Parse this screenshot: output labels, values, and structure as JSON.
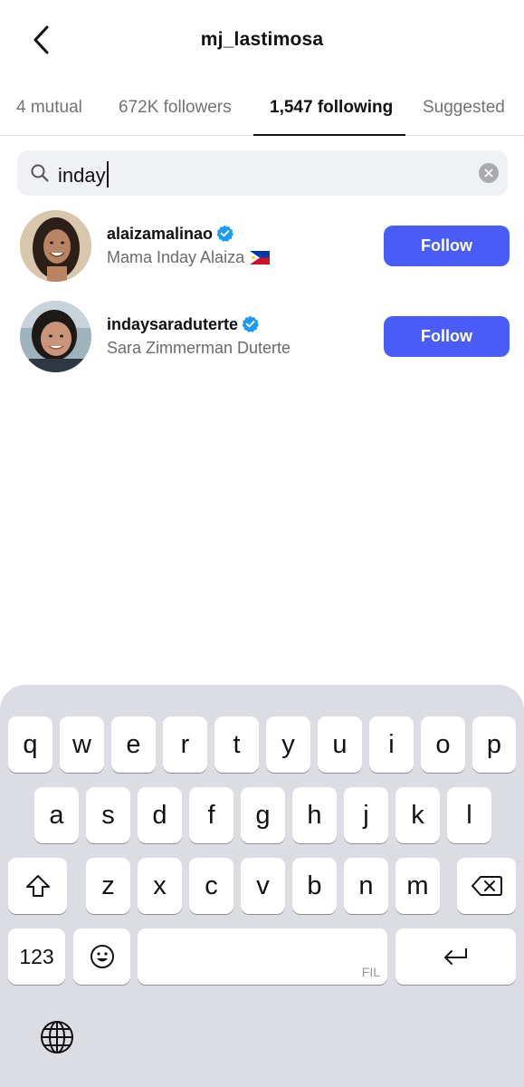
{
  "header": {
    "title": "mj_lastimosa"
  },
  "tabs": [
    {
      "label": "4 mutual",
      "active": false
    },
    {
      "label": "672K followers",
      "active": false
    },
    {
      "label": "1,547 following",
      "active": true
    },
    {
      "label": "Suggested",
      "active": false
    }
  ],
  "search": {
    "query": "inday"
  },
  "results": [
    {
      "username": "alaizamalinao",
      "full_name": "Mama Inday Alaiza",
      "verified": true,
      "flag": "philippines-flag-emoji",
      "button": "Follow"
    },
    {
      "username": "indaysaraduterte",
      "full_name": "Sara Zimmerman Duterte",
      "verified": true,
      "button": "Follow"
    }
  ],
  "keyboard": {
    "row1": [
      "q",
      "w",
      "e",
      "r",
      "t",
      "y",
      "u",
      "i",
      "o",
      "p"
    ],
    "row2": [
      "a",
      "s",
      "d",
      "f",
      "g",
      "h",
      "j",
      "k",
      "l"
    ],
    "row3": [
      "z",
      "x",
      "c",
      "v",
      "b",
      "n",
      "m"
    ],
    "numbers_key": "123",
    "space_language": "FIL"
  },
  "colors": {
    "accent": "#4a5cf6",
    "verified": "#1d9bf0",
    "keyboard_bg": "#dcdde2"
  }
}
